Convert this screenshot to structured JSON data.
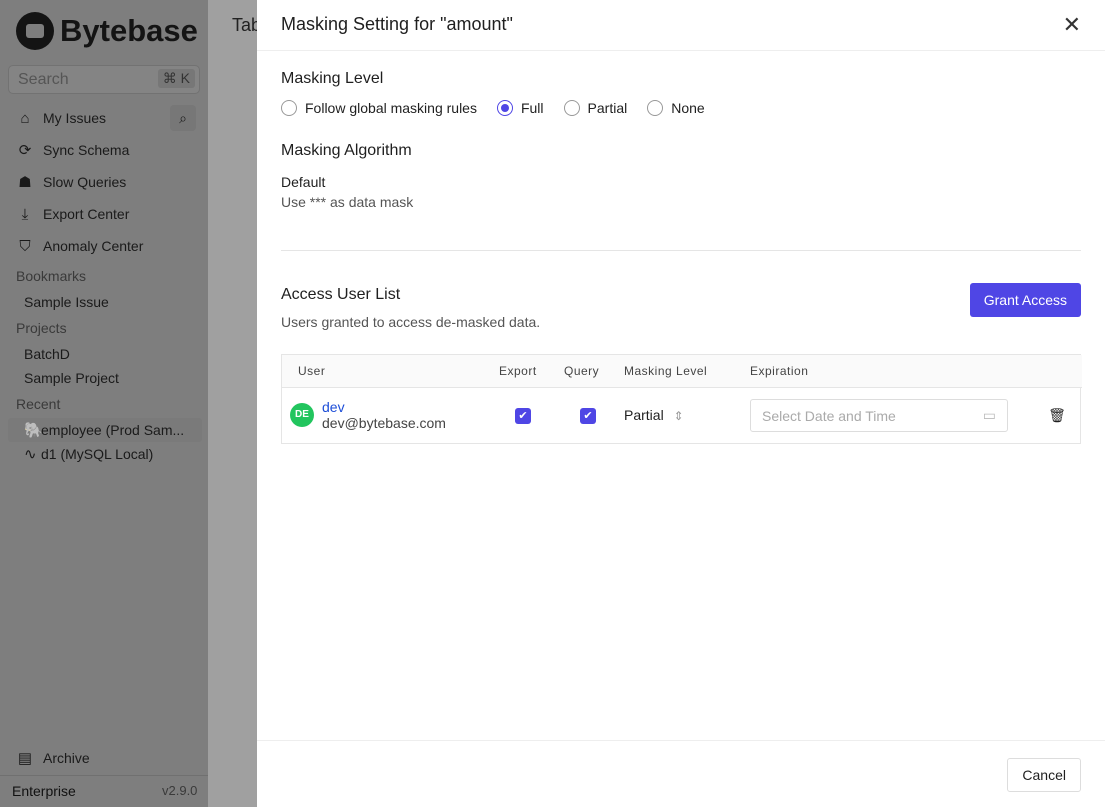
{
  "sidebar": {
    "brand": "Bytebase",
    "search_placeholder": "Search",
    "search_shortcut": "⌘ K",
    "nav": [
      {
        "label": "My Issues",
        "icon": "home-icon"
      },
      {
        "label": "Sync Schema",
        "icon": "sync-icon"
      },
      {
        "label": "Slow Queries",
        "icon": "turtle-icon"
      },
      {
        "label": "Export Center",
        "icon": "download-icon"
      },
      {
        "label": "Anomaly Center",
        "icon": "shield-icon"
      }
    ],
    "bookmarks_label": "Bookmarks",
    "bookmarks": [
      "Sample Issue"
    ],
    "projects_label": "Projects",
    "projects": [
      "BatchD",
      "Sample Project"
    ],
    "recent_label": "Recent",
    "recent": [
      "employee (Prod Sam...",
      "d1 (MySQL Local)"
    ],
    "archive": "Archive",
    "plan": "Enterprise",
    "version": "v2.9.0"
  },
  "main": {
    "title_fragment": "Tab"
  },
  "drawer": {
    "title": "Masking Setting for \"amount\"",
    "masking_level_label": "Masking Level",
    "levels": [
      "Follow global masking rules",
      "Full",
      "Partial",
      "None"
    ],
    "selected_level": "Full",
    "algorithm_label": "Masking Algorithm",
    "algorithm_name": "Default",
    "algorithm_desc": "Use *** as data mask",
    "access_title": "Access User List",
    "access_desc": "Users granted to access de-masked data.",
    "grant_button": "Grant Access",
    "columns": [
      "User",
      "Export",
      "Query",
      "Masking Level",
      "Expiration"
    ],
    "rows": [
      {
        "initials": "DE",
        "name": "dev",
        "email": "dev@bytebase.com",
        "export": true,
        "query": true,
        "masking_level": "Partial",
        "expiration_placeholder": "Select Date and Time"
      }
    ],
    "cancel": "Cancel"
  },
  "colors": {
    "accent": "#4f46e5",
    "avatar": "#22c55e"
  }
}
